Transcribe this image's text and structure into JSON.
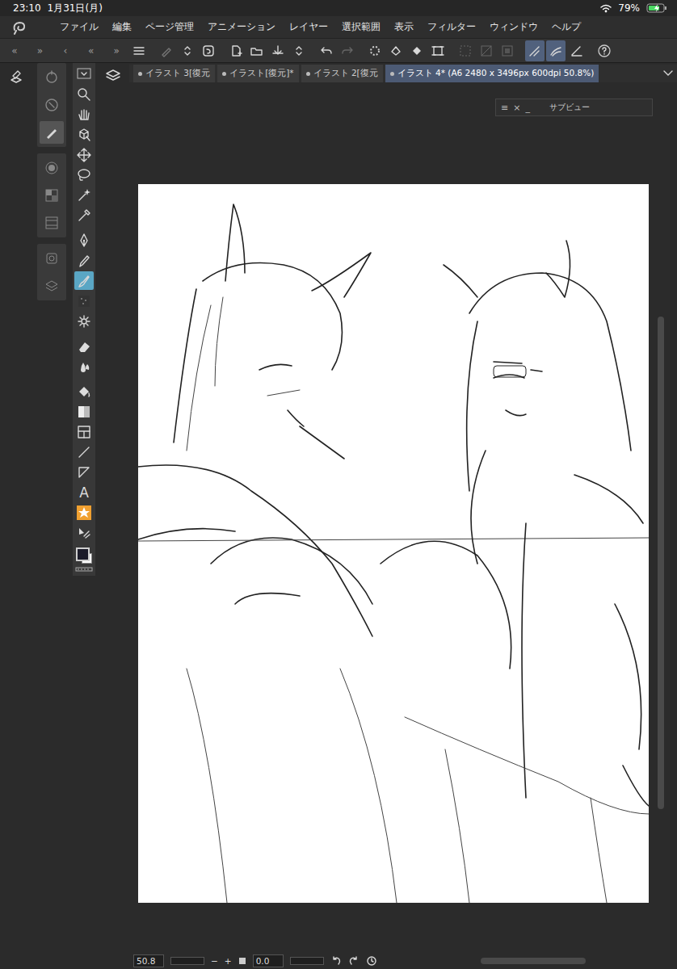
{
  "status_bar": {
    "time": "23:10",
    "date": "1月31日(月)",
    "battery": "79%",
    "battery_level": 0.79,
    "charging": true
  },
  "menu": [
    "ファイル",
    "編集",
    "ページ管理",
    "アニメーション",
    "レイヤー",
    "選択範囲",
    "表示",
    "フィルター",
    "ウィンドウ",
    "ヘルプ"
  ],
  "collapse_arrows": [
    "«",
    "»",
    "‹",
    "«",
    "»"
  ],
  "command_bar": [
    {
      "selected": false
    },
    {
      "selected": false
    },
    {
      "selected": false
    },
    {
      "selected": false
    },
    {
      "selected": false
    },
    {
      "selected": false
    },
    {
      "selected": false
    },
    {
      "selected": false
    },
    {
      "selected": false
    },
    {
      "selected": false
    },
    {
      "selected": false
    },
    {
      "selected": false
    },
    {
      "selected": false
    },
    {
      "selected": false
    },
    {
      "selected": false
    },
    {
      "selected": false
    },
    {
      "selected": false
    },
    {
      "selected": true
    },
    {
      "selected": true
    },
    {
      "selected": false
    },
    {
      "selected": false
    }
  ],
  "side_panels": [
    [
      {
        "selected": false
      },
      {
        "selected": false
      },
      {
        "selected": true
      }
    ],
    [
      {
        "selected": false
      },
      {
        "selected": false
      },
      {
        "selected": false
      }
    ],
    [
      {
        "selected": false
      },
      {
        "selected": false
      }
    ]
  ],
  "tools": [
    {
      "kind": "icon",
      "selected": false
    },
    {
      "kind": "icon",
      "selected": false
    },
    {
      "kind": "icon",
      "selected": false
    },
    {
      "kind": "icon",
      "selected": false
    },
    {
      "kind": "icon",
      "selected": false
    },
    {
      "kind": "icon",
      "selected": false
    },
    {
      "kind": "icon",
      "selected": false
    },
    {
      "kind": "icon",
      "selected": false
    },
    {
      "kind": "icon",
      "selected": false
    },
    {
      "kind": "icon",
      "selected": false
    },
    {
      "kind": "icon",
      "selected": true
    },
    {
      "kind": "icon",
      "selected": false
    },
    {
      "kind": "icon",
      "selected": false
    },
    {
      "kind": "icon",
      "selected": false
    },
    {
      "kind": "icon",
      "selected": false
    },
    {
      "kind": "icon",
      "selected": false
    },
    {
      "kind": "icon",
      "selected": false
    },
    {
      "kind": "icon",
      "selected": false
    },
    {
      "kind": "icon",
      "selected": false
    },
    {
      "kind": "icon",
      "selected": false
    },
    {
      "kind": "glyph",
      "glyph": "A",
      "selected": false
    },
    {
      "kind": "icon",
      "selected": false
    },
    {
      "kind": "icon",
      "selected": false
    }
  ],
  "tabs": [
    {
      "label": "イラスト 3[復元",
      "selected": false
    },
    {
      "label": "イラスト[復元]*",
      "selected": false
    },
    {
      "label": "イラスト 2[復元",
      "selected": false
    },
    {
      "label": "イラスト 4* (A6 2480 x 3496px 600dpi 50.8%)",
      "selected": true
    }
  ],
  "subview": {
    "controls": [
      "≡",
      "×",
      "_"
    ],
    "title": "サブビュー"
  },
  "bottom_bar": {
    "zoom": "50.8",
    "zoom_buttons": [
      "−",
      "+"
    ],
    "rotation": "0.0"
  }
}
